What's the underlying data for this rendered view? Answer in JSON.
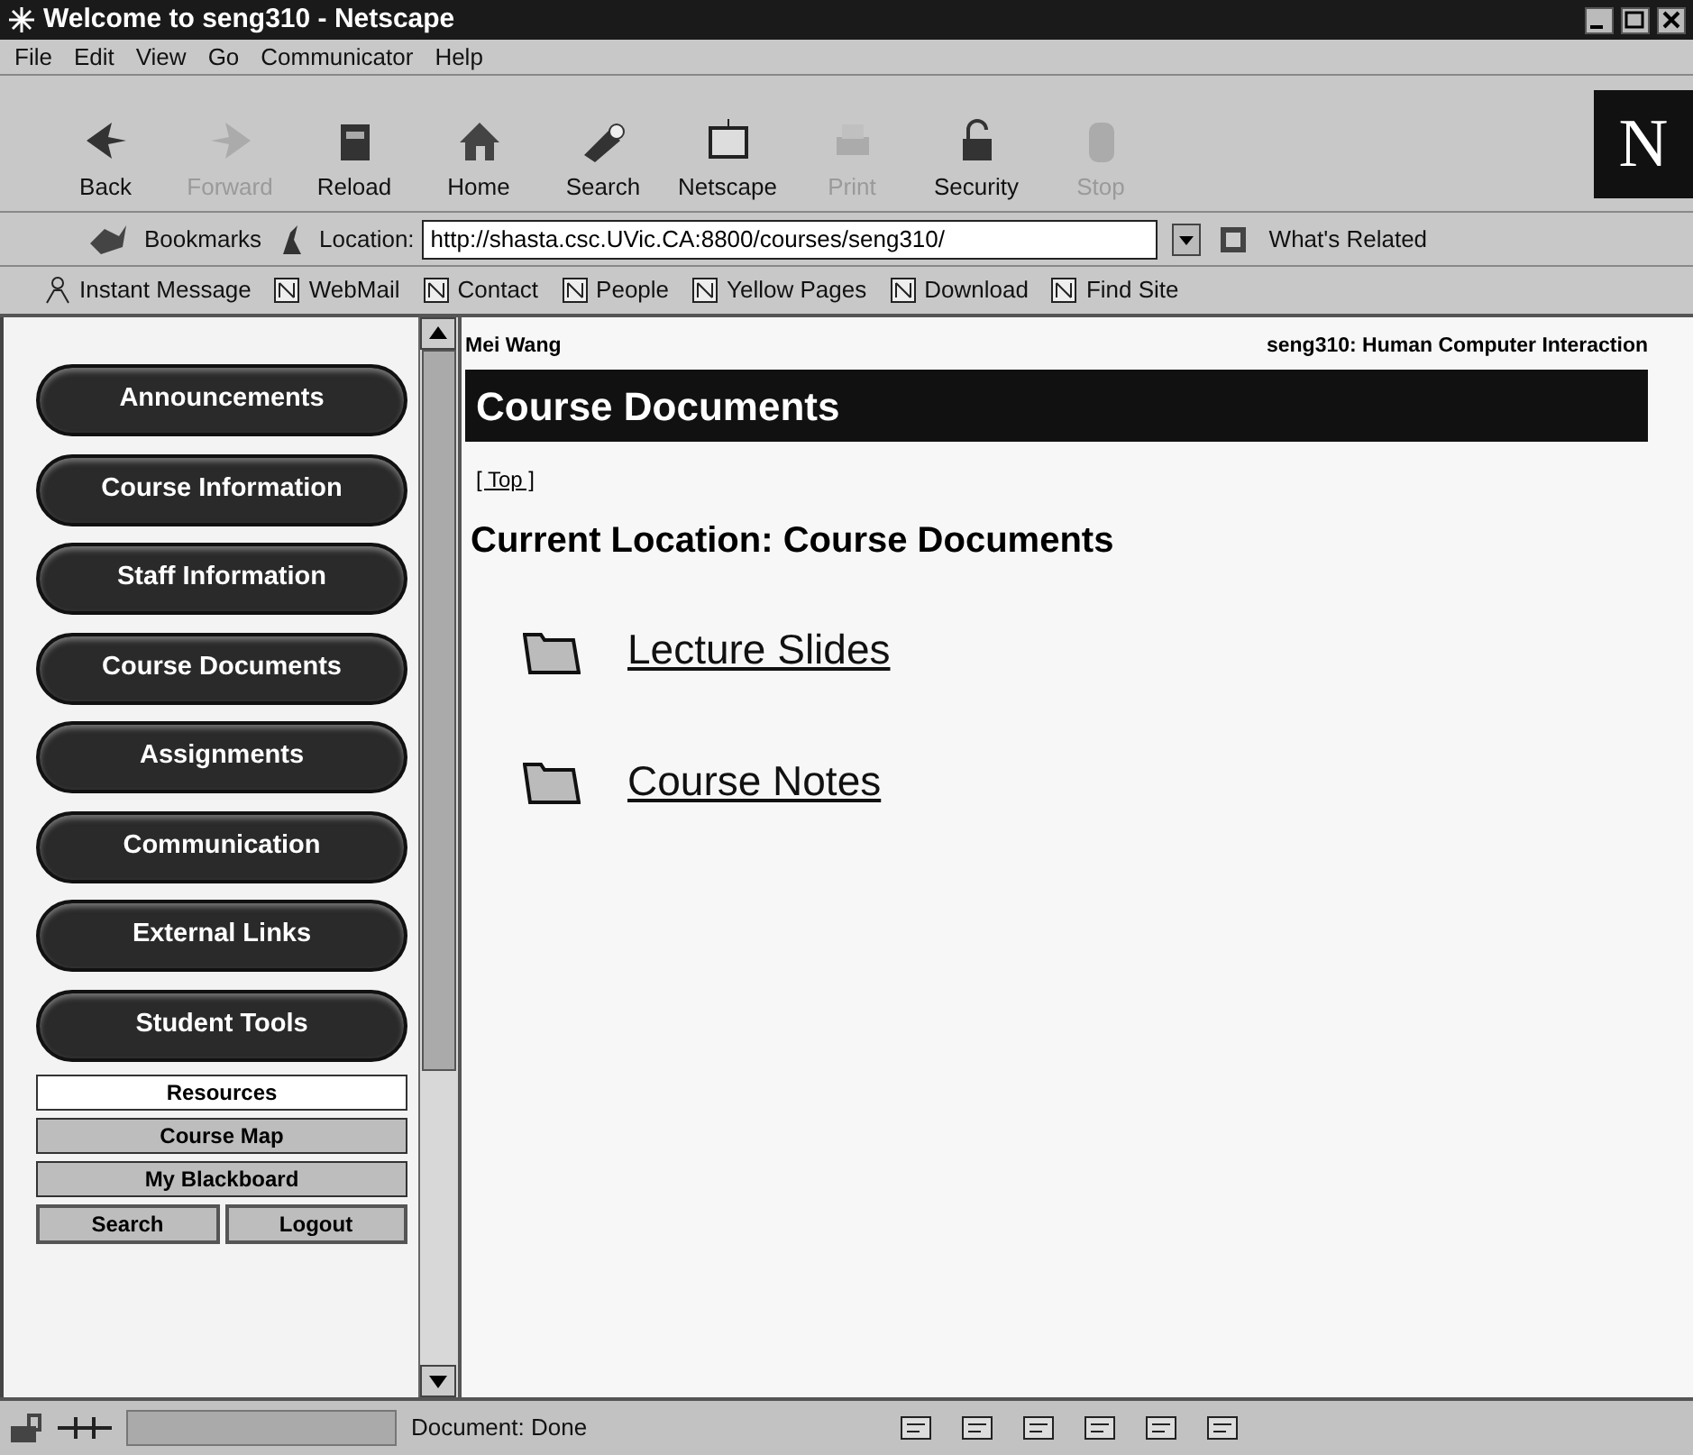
{
  "window": {
    "title": "Welcome to seng310 - Netscape"
  },
  "menu": [
    "File",
    "Edit",
    "View",
    "Go",
    "Communicator",
    "Help"
  ],
  "toolbar": [
    {
      "label": "Back",
      "disabled": false
    },
    {
      "label": "Forward",
      "disabled": true
    },
    {
      "label": "Reload",
      "disabled": false
    },
    {
      "label": "Home",
      "disabled": false
    },
    {
      "label": "Search",
      "disabled": false
    },
    {
      "label": "Netscape",
      "disabled": false
    },
    {
      "label": "Print",
      "disabled": true
    },
    {
      "label": "Security",
      "disabled": false
    },
    {
      "label": "Stop",
      "disabled": true
    }
  ],
  "logo": "N",
  "location_bar": {
    "bookmarks": "Bookmarks",
    "location_label": "Location:",
    "url": "http://shasta.csc.UVic.CA:8800/courses/seng310/",
    "whats_related": "What's Related"
  },
  "personal_toolbar": [
    "Instant Message",
    "WebMail",
    "Contact",
    "People",
    "Yellow Pages",
    "Download",
    "Find Site"
  ],
  "sidebar": {
    "nav_buttons": [
      "Announcements",
      "Course Information",
      "Staff Information",
      "Course Documents",
      "Assignments",
      "Communication",
      "External Links",
      "Student Tools"
    ],
    "small_buttons": [
      {
        "label": "Resources",
        "selected": true
      },
      {
        "label": "Course Map",
        "selected": false
      },
      {
        "label": "My Blackboard",
        "selected": false
      }
    ],
    "bottom_buttons": [
      "Search",
      "Logout"
    ]
  },
  "page": {
    "user": "Mei Wang",
    "course": "seng310: Human Computer Interaction",
    "heading": "Course Documents",
    "top_link": "[ Top ]",
    "current_location": "Current Location: Course Documents",
    "folders": [
      "Lecture Slides",
      "Course Notes"
    ]
  },
  "status_bar": {
    "text": "Document: Done"
  }
}
